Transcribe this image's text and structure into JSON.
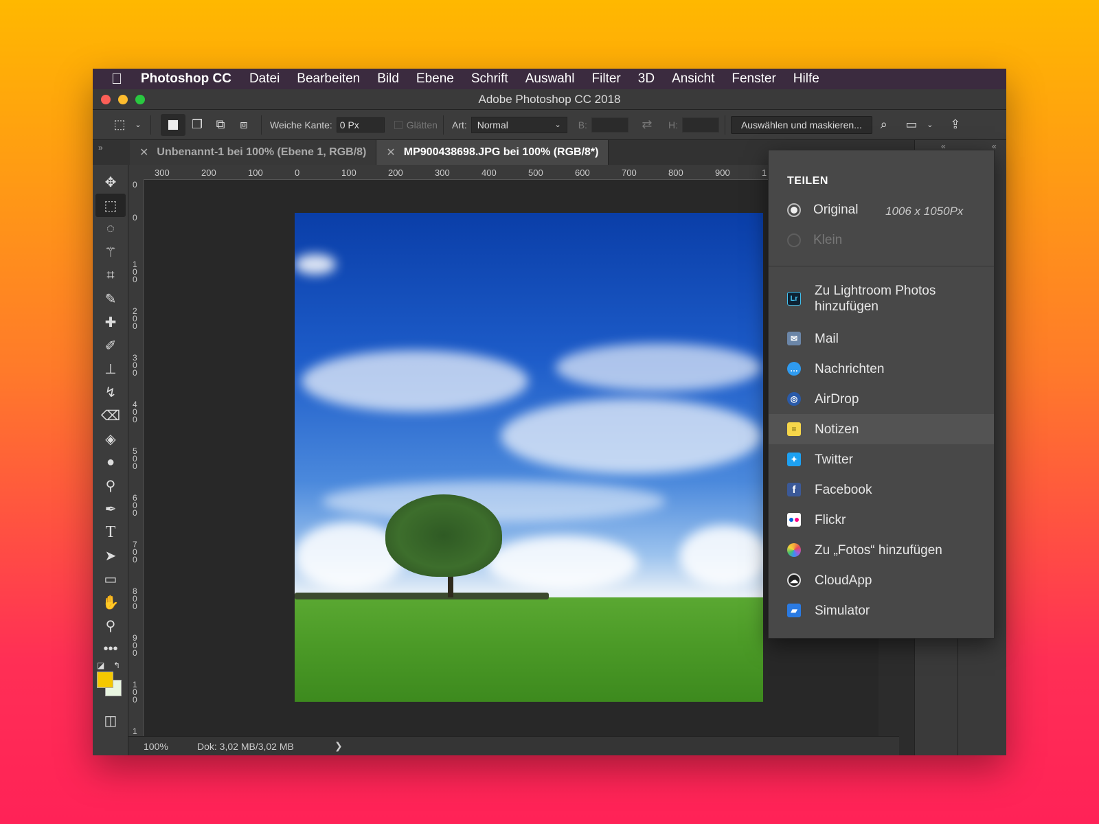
{
  "menubar": {
    "app": "Photoshop CC",
    "items": [
      "Datei",
      "Bearbeiten",
      "Bild",
      "Ebene",
      "Schrift",
      "Auswahl",
      "Filter",
      "3D",
      "Ansicht",
      "Fenster",
      "Hilfe"
    ]
  },
  "window": {
    "title": "Adobe Photoshop CC 2018"
  },
  "options": {
    "feather_label": "Weiche Kante:",
    "feather_value": "0 Px",
    "antialias_label": "Glätten",
    "style_label": "Art:",
    "style_value": "Normal",
    "width_label": "B:",
    "height_label": "H:",
    "select_mask_button": "Auswählen und maskieren..."
  },
  "tabs": [
    {
      "label": "Unbenannt-1 bei 100% (Ebene 1, RGB/8)",
      "active": false
    },
    {
      "label": "MP900438698.JPG bei 100% (RGB/8*)",
      "active": true
    }
  ],
  "ruler_h": [
    "300",
    "200",
    "100",
    "0",
    "100",
    "200",
    "300",
    "400",
    "500",
    "600",
    "700",
    "800",
    "900",
    "1"
  ],
  "ruler_v": [
    "0",
    "0",
    "100",
    "200",
    "300",
    "400",
    "500",
    "600",
    "700",
    "800",
    "900",
    "100",
    "1"
  ],
  "status": {
    "zoom": "100%",
    "doc": "Dok: 3,02 MB/3,02 MB",
    "arrow": "❯"
  },
  "share": {
    "heading": "TEILEN",
    "original_label": "Original",
    "original_size": "1006 x 1050Px",
    "small_label": "Klein",
    "items": [
      {
        "label": "Zu Lightroom Photos hinzufügen",
        "icon": "lightroom-icon",
        "color": "#0e2233"
      },
      {
        "label": "Mail",
        "icon": "mail-icon",
        "color": "#6b86a8"
      },
      {
        "label": "Nachrichten",
        "icon": "messages-icon",
        "color": "#2f9bf0"
      },
      {
        "label": "AirDrop",
        "icon": "airdrop-icon",
        "color": "#2a5aa8"
      },
      {
        "label": "Notizen",
        "icon": "notes-icon",
        "color": "#f6d64a"
      },
      {
        "label": "Twitter",
        "icon": "twitter-icon",
        "color": "#1da1f2"
      },
      {
        "label": "Facebook",
        "icon": "facebook-icon",
        "color": "#3b5998"
      },
      {
        "label": "Flickr",
        "icon": "flickr-icon",
        "color": "#ffffff"
      },
      {
        "label": "Zu „Fotos“ hinzufügen",
        "icon": "photos-icon",
        "color": "#f3a93a"
      },
      {
        "label": "CloudApp",
        "icon": "cloudapp-icon",
        "color": "#222222"
      },
      {
        "label": "Simulator",
        "icon": "simulator-icon",
        "color": "#2a7ae2"
      }
    ]
  },
  "colors": {
    "foreground": "#f5c800",
    "background": "#e8f5e0"
  }
}
